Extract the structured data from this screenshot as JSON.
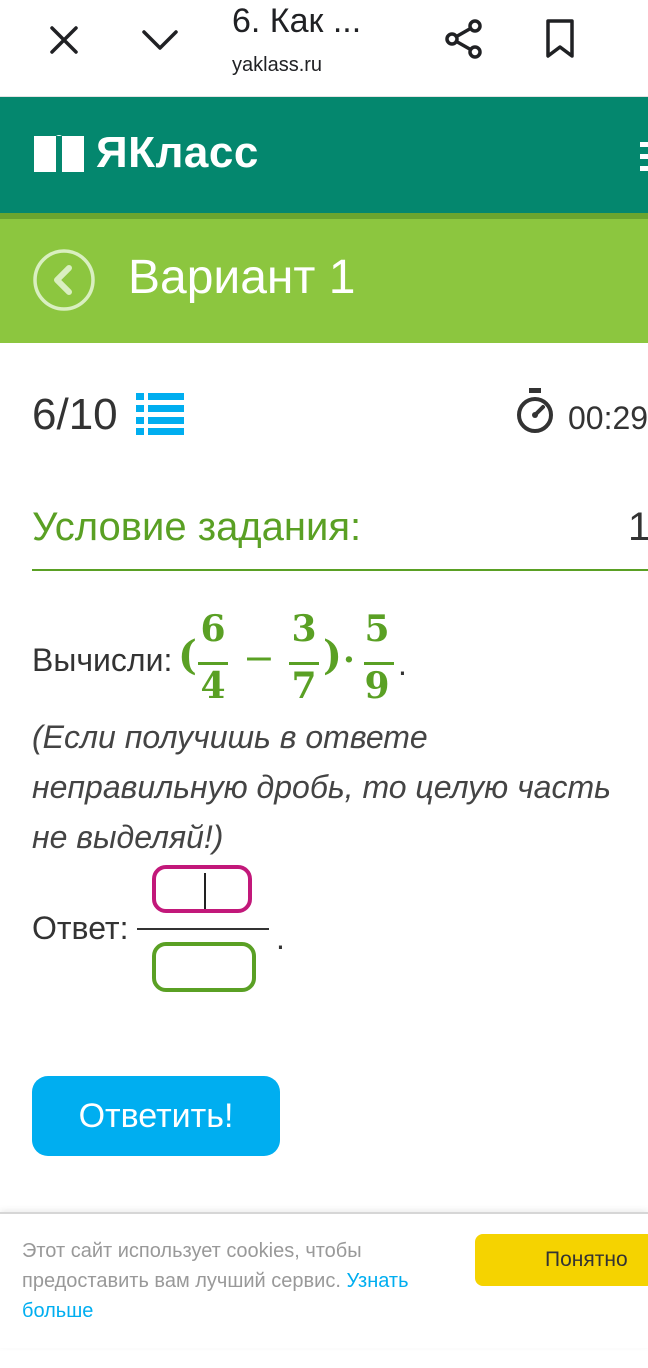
{
  "browser": {
    "title": "6. Как ...",
    "url": "yaklass.ru",
    "icons": [
      "close-icon",
      "chevron-down-icon",
      "share-icon",
      "bookmark-icon"
    ]
  },
  "header": {
    "logo_text": "ЯКласс",
    "icons": [
      "book-logo-icon",
      "menu-icon"
    ]
  },
  "variant": {
    "title": "Вариант 1",
    "icons": [
      "back-arrow-icon"
    ]
  },
  "progress": {
    "current": "6/10",
    "timer": "00:29",
    "icons": [
      "list-icon",
      "stopwatch-icon"
    ]
  },
  "task": {
    "heading": "Условие задания:",
    "number": "1",
    "compute_label": "Вычисли:",
    "expression": {
      "open_paren": "(",
      "frac1": {
        "num": "6",
        "den": "4"
      },
      "minus": "−",
      "frac2": {
        "num": "3",
        "den": "7"
      },
      "close_paren": ")",
      "dot": "·",
      "frac3": {
        "num": "5",
        "den": "9"
      },
      "end": "."
    },
    "hint": "(Если получишь в ответе неправильную дробь, то целую часть не выделяй!)"
  },
  "answer": {
    "label": "Ответ:",
    "numerator_value": "",
    "denominator_value": "",
    "end": ".",
    "submit_label": "Ответить!"
  },
  "cookie": {
    "text": "Этот сайт использует cookies, чтобы предоставить вам лучший сервис.",
    "link": "Узнать больше",
    "button": "Понятно"
  },
  "colors": {
    "header_bg": "#04876e",
    "variant_bg": "#8cc63f",
    "accent_green": "#5aa024",
    "submit_blue": "#00aef0",
    "cookie_button": "#f5d300",
    "numerator_border": "#c2187a"
  }
}
